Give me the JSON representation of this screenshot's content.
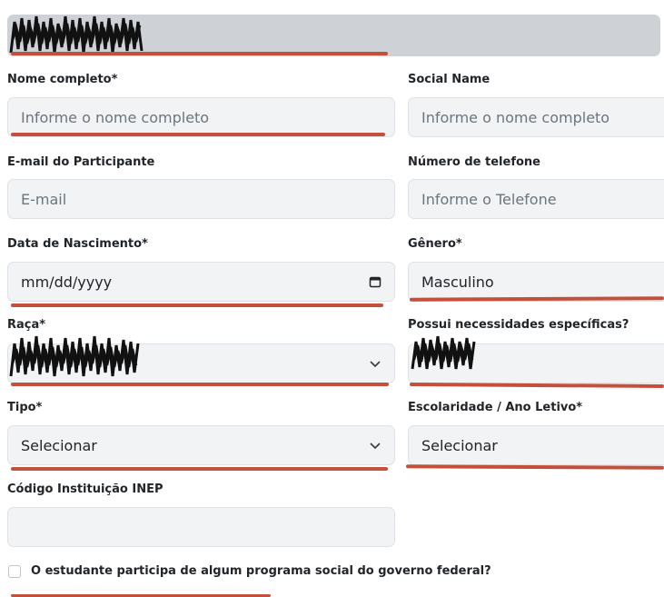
{
  "form": {
    "full_name": {
      "label": "Nome completo*",
      "placeholder": "Informe o nome completo"
    },
    "social_name": {
      "label": "Social Name",
      "placeholder": "Informe o nome completo"
    },
    "email": {
      "label": "E-mail do Participante",
      "placeholder": "E-mail"
    },
    "phone": {
      "label": "Número de telefone",
      "placeholder": "Informe o Telefone"
    },
    "birth_date": {
      "label": "Data de Nascimento*",
      "value": "mm/dd/yyyy"
    },
    "gender": {
      "label": "Gênero*",
      "value": "Masculino"
    },
    "race": {
      "label": "Raça*"
    },
    "special_needs": {
      "label": "Possui necessidades específicas?"
    },
    "type": {
      "label": "Tipo*",
      "value": "Selecionar"
    },
    "schooling": {
      "label": "Escolaridade / Ano Letivo*",
      "value": "Selecionar"
    },
    "inep_code": {
      "label": "Código Instituição INEP"
    },
    "social_program": {
      "label": "O estudante participa de algum programa social do governo federal?"
    }
  },
  "colors": {
    "annotation_red": "#c4503c",
    "field_bg": "#f1f3f5",
    "header_bar": "#ced1d6"
  },
  "icons": {
    "calendar": "calendar-icon",
    "chevron": "chevron-down-icon"
  }
}
